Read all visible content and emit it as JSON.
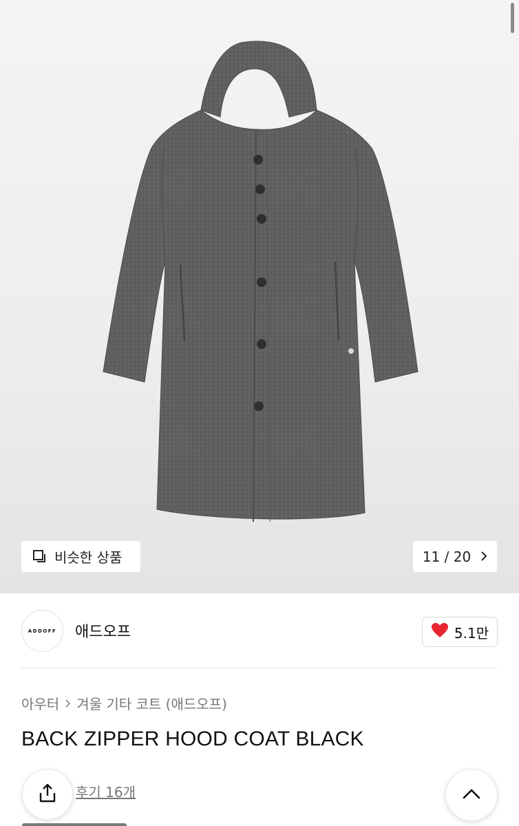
{
  "hero": {
    "image_alt": "grey wool hooded coat",
    "similar_label": "비슷한 상품",
    "counter": "11 / 20"
  },
  "brand": {
    "logo_text": "ADDOFF",
    "name": "애드오프",
    "likes": "5.1만"
  },
  "breadcrumb": {
    "category": "아우터",
    "separator": ">",
    "subcategory": "겨울 기타 코트 (애드오프)"
  },
  "product": {
    "title": "BACK ZIPPER HOOD COAT BLACK",
    "reviews": "후기 16개"
  },
  "colors": {
    "heart": "#e8262f",
    "coat": "#5e5e5e"
  },
  "icons": {
    "similar": "copy-icon",
    "next": "chevron-right-icon",
    "like": "heart-icon",
    "share": "share-icon",
    "top": "chevron-up-icon"
  }
}
